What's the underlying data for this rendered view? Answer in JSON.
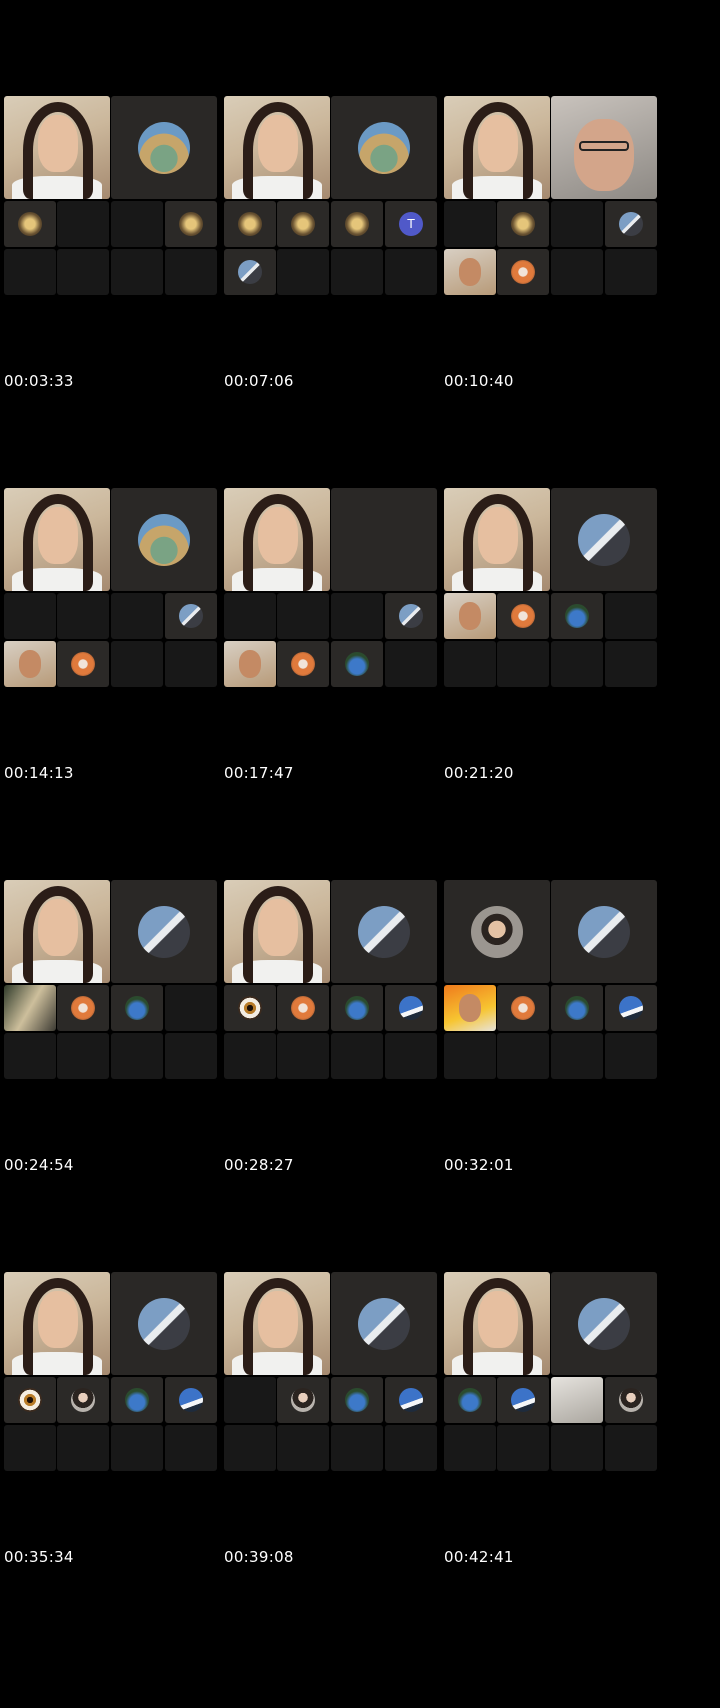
{
  "frames": [
    {
      "timestamp": "00:03:33"
    },
    {
      "timestamp": "00:07:06"
    },
    {
      "timestamp": "00:10:40"
    },
    {
      "timestamp": "00:14:13"
    },
    {
      "timestamp": "00:17:47"
    },
    {
      "timestamp": "00:21:20"
    },
    {
      "timestamp": "00:24:54"
    },
    {
      "timestamp": "00:28:27"
    },
    {
      "timestamp": "00:32:01"
    },
    {
      "timestamp": "00:35:34"
    },
    {
      "timestamp": "00:39:08"
    },
    {
      "timestamp": "00:42:41"
    }
  ],
  "avatar_letters": {
    "t": "T"
  },
  "theme": {
    "background": "#000000",
    "tile": "#1b1b1b",
    "accent": "#5059c9"
  }
}
